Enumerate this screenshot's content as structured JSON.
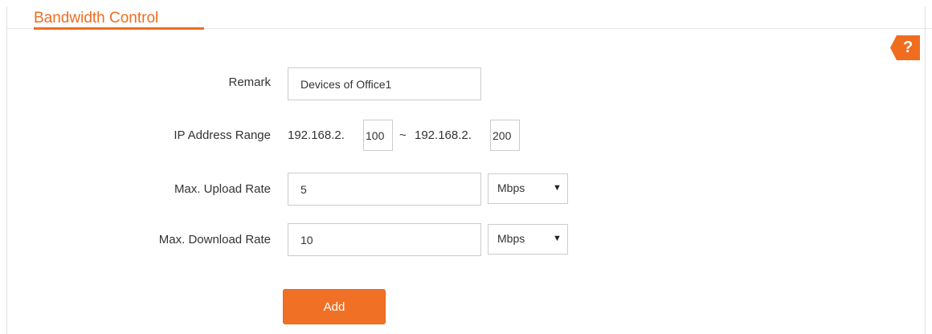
{
  "section": {
    "title": "Bandwidth Control"
  },
  "help": {
    "glyph": "?",
    "icon": "question-icon",
    "color": "#f06d1f"
  },
  "form": {
    "remark": {
      "label": "Remark",
      "value": "Devices of Office1"
    },
    "ip_range": {
      "label": "IP Address Range",
      "start_prefix": "192.168.2.",
      "start_value": "100",
      "separator": "~",
      "end_prefix": "192.168.2.",
      "end_value": "200"
    },
    "upload": {
      "label": "Max. Upload Rate",
      "value": "5",
      "unit": "Mbps"
    },
    "download": {
      "label": "Max. Download Rate",
      "value": "10",
      "unit": "Mbps"
    }
  },
  "actions": {
    "add_label": "Add"
  },
  "colors": {
    "accent": "#f06d1f",
    "button": "#f07126",
    "border": "#cccccc"
  }
}
